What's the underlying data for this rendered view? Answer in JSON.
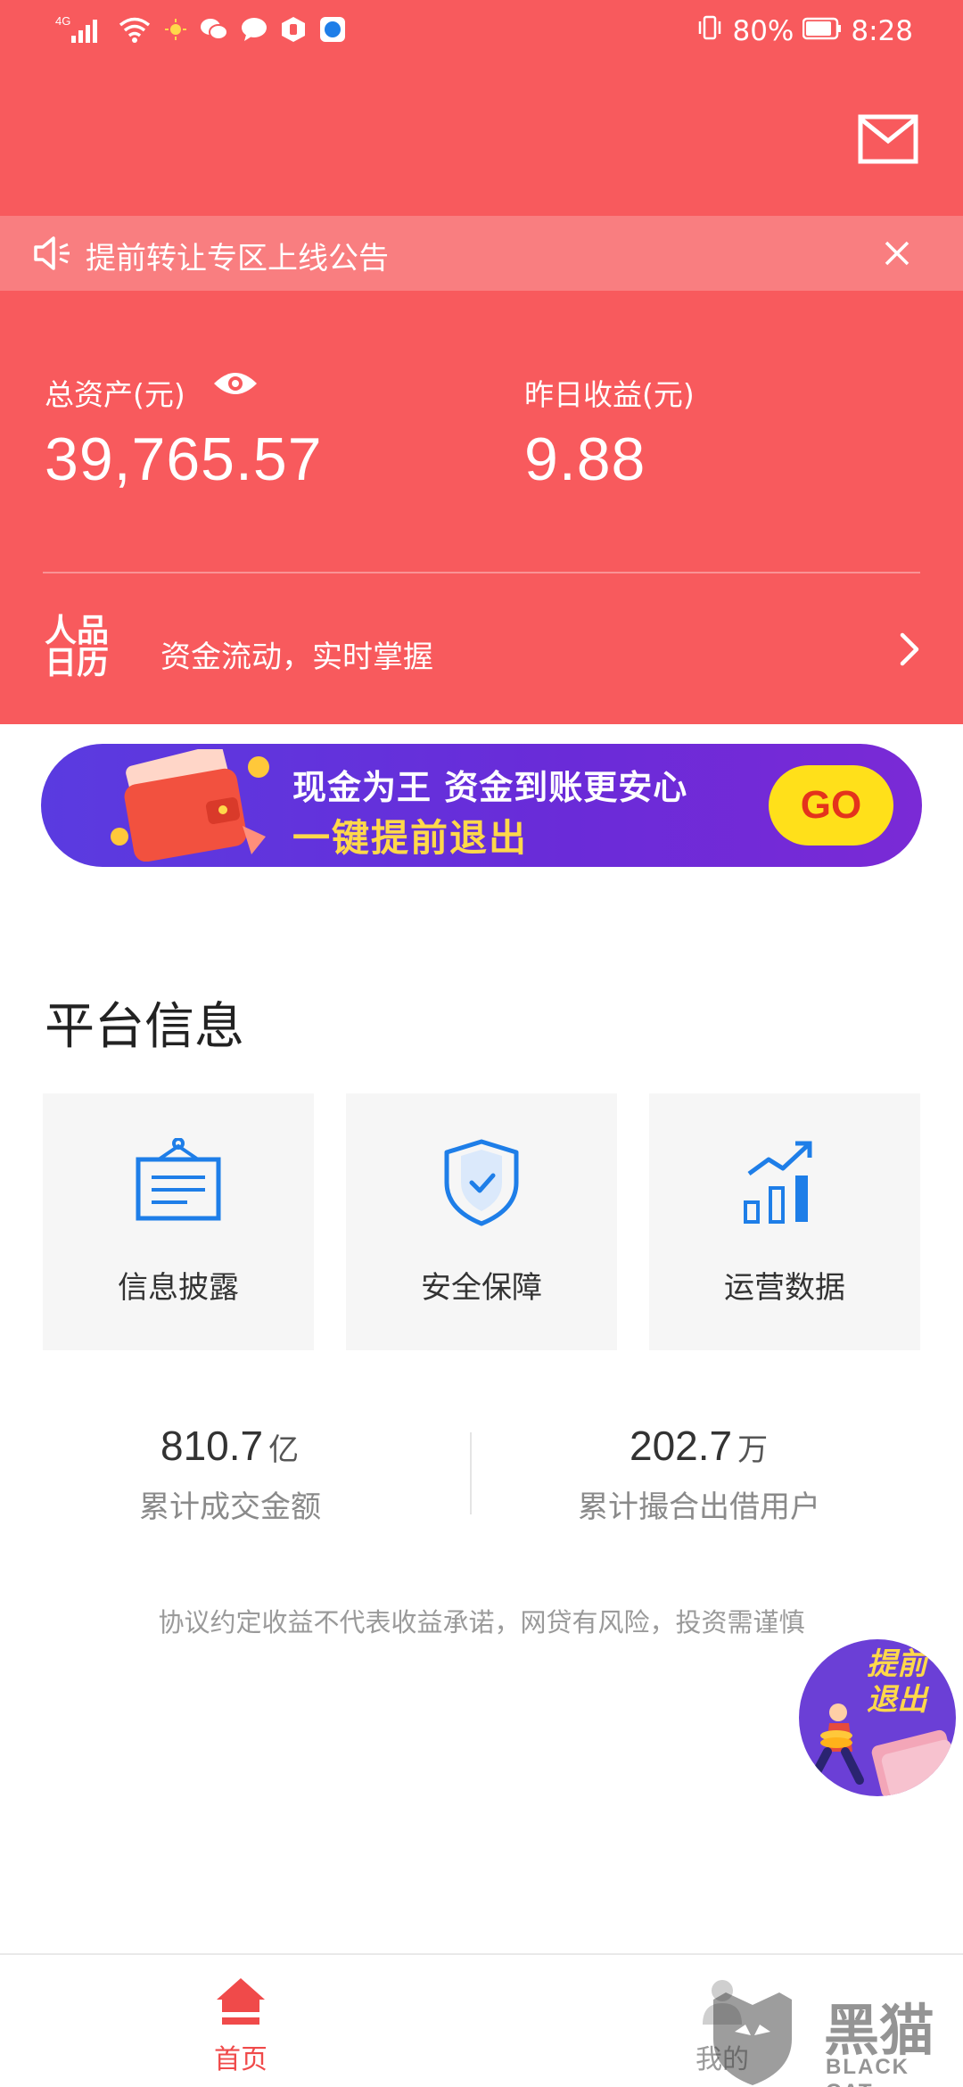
{
  "status_bar": {
    "network": "4G",
    "battery_percent": "80%",
    "time": "8:28"
  },
  "header": {
    "mail_icon": "envelope-icon"
  },
  "notice": {
    "text": "提前转让专区上线公告",
    "speaker_icon": "speaker-icon",
    "close_icon": "close-icon"
  },
  "assets": {
    "total_label": "总资产(元)",
    "total_value": "39,765.57",
    "yesterday_label": "昨日收益(元)",
    "yesterday_value": "9.88",
    "eye_icon": "eye-icon"
  },
  "calendar": {
    "logo": [
      "人品",
      "日历"
    ],
    "text": "资金流动，实时掌握",
    "chevron_icon": "chevron-right-icon"
  },
  "banner": {
    "line1": "现金为王 资金到账更安心",
    "line2": "一键提前退出",
    "button": "GO"
  },
  "platform": {
    "title": "平台信息",
    "cards": [
      {
        "label": "信息披露",
        "icon": "notice-board-icon"
      },
      {
        "label": "安全保障",
        "icon": "shield-check-icon"
      },
      {
        "label": "运营数据",
        "icon": "bar-chart-trend-icon"
      }
    ]
  },
  "stats": [
    {
      "value": "810.7",
      "unit": "亿",
      "label": "累计成交金额"
    },
    {
      "value": "202.7",
      "unit": "万",
      "label": "累计撮合出借用户"
    }
  ],
  "disclaimer": "协议约定收益不代表收益承诺，网贷有风险，投资需谨慎",
  "floating_button": {
    "text": [
      "提前",
      "退出"
    ]
  },
  "tabbar": {
    "items": [
      {
        "label": "首页",
        "icon": "home-icon",
        "active": true
      },
      {
        "label": "我的",
        "icon": "profile-icon",
        "active": false
      }
    ]
  },
  "watermark": {
    "line1": "黑猫",
    "line2": "BLACK CAT"
  },
  "colors": {
    "primary": "#f85a5d",
    "banner_purple": "#5a3be0",
    "go_yellow": "#ffe01a",
    "icon_blue": "#1e7ee8"
  }
}
